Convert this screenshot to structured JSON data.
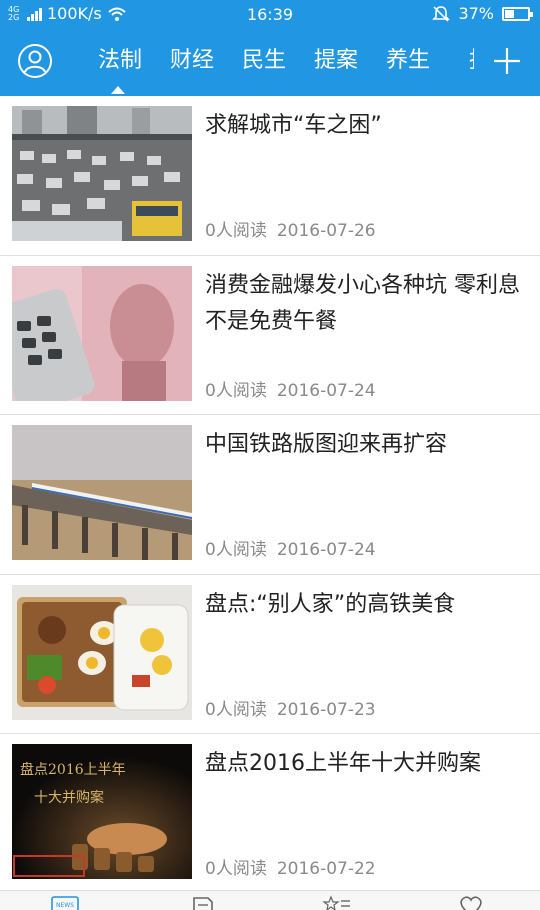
{
  "status_bar": {
    "network_label": "4G\n2G",
    "speed": "100K/s",
    "time": "16:39",
    "battery": "37%",
    "battery_level": 0.37,
    "icons": [
      "signal-icon",
      "wifi-icon",
      "mute-bell-icon",
      "battery-icon"
    ]
  },
  "nav": {
    "tabs": [
      "法制",
      "财经",
      "民生",
      "提案",
      "养生",
      "报"
    ],
    "active_tab": "法制",
    "icons": [
      "avatar-icon",
      "plus-icon"
    ],
    "accent": "#2196e3"
  },
  "articles": [
    {
      "title": "求解城市“车之困”",
      "reads": "0人阅读",
      "date": "2016-07-26"
    },
    {
      "title": "消费金融爆发小心各种坑 零利息不是免费午餐",
      "reads": "0人阅读",
      "date": "2016-07-24"
    },
    {
      "title": "中国铁路版图迎来再扩容",
      "reads": "0人阅读",
      "date": "2016-07-24"
    },
    {
      "title": "盘点:“别人家”的高铁美食",
      "reads": "0人阅读",
      "date": "2016-07-23"
    },
    {
      "title": "盘点2016上半年十大并购案",
      "reads": "0人阅读",
      "date": "2016-07-22",
      "thumb_text": [
        "盘点2016上半年",
        "十大并购案"
      ]
    }
  ],
  "bottom_nav": {
    "icons": [
      "news-icon",
      "document-icon",
      "favorites-icon",
      "heart-icon"
    ],
    "news_label": "NEWS"
  }
}
